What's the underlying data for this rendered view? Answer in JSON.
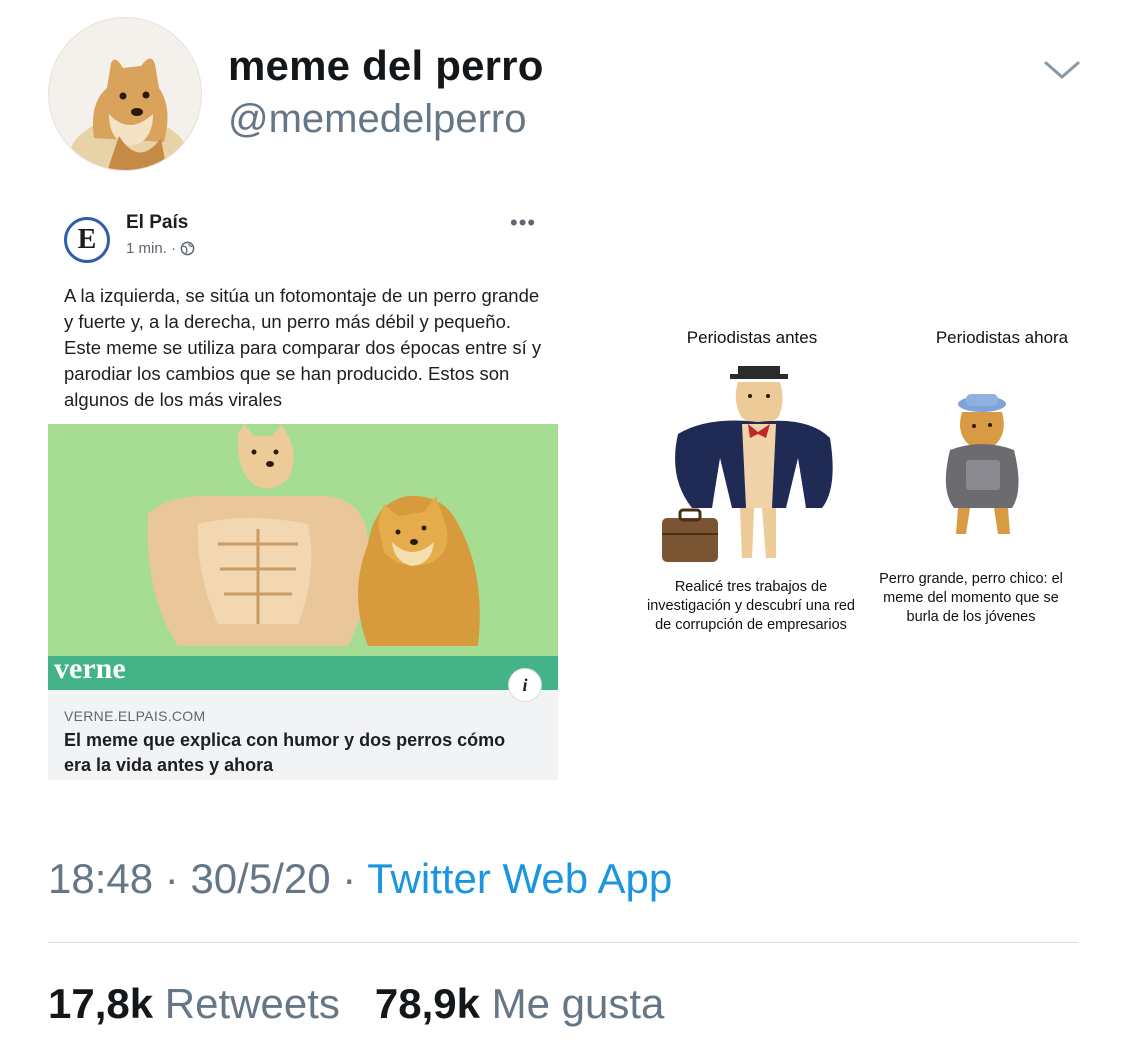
{
  "tweet": {
    "display_name": "meme del perro",
    "handle": "@memedelperro",
    "time": "18:48",
    "date": "30/5/20",
    "separator": "·",
    "source": "Twitter Web App",
    "retweets_count": "17,8k",
    "retweets_label": "Retweets",
    "likes_count": "78,9k",
    "likes_label": "Me gusta"
  },
  "embed": {
    "page_name": "El País",
    "logo_letter": "E",
    "posted": "1 min. ·",
    "more": "•••",
    "post_text": "A la izquierda, se sitúa un fotomontaje de un perro grande y fuerte y, a la derecha, un perro más débil y pequeño. Este meme se utiliza para comparar dos épocas entre sí y parodiar los cambios que se han producido. Estos son algunos de los más virales",
    "brand": "verne",
    "info": "i",
    "link_domain": "VERNE.ELPAIS.COM",
    "link_title": "El meme que explica con humor y dos perros cómo era la vida antes y ahora"
  },
  "meme": {
    "left_title": "Periodistas antes",
    "right_title": "Periodistas ahora",
    "left_caption": "Realicé tres trabajos de investigación y descubrí una red de corrupción de empresarios",
    "right_caption": "Perro grande, perro chico: el meme del momento que se burla de los jóvenes"
  },
  "colors": {
    "link_blue": "#1b95e0",
    "muted_gray": "#657786",
    "image_green": "#a7dc93",
    "verne_green": "#45b388"
  }
}
